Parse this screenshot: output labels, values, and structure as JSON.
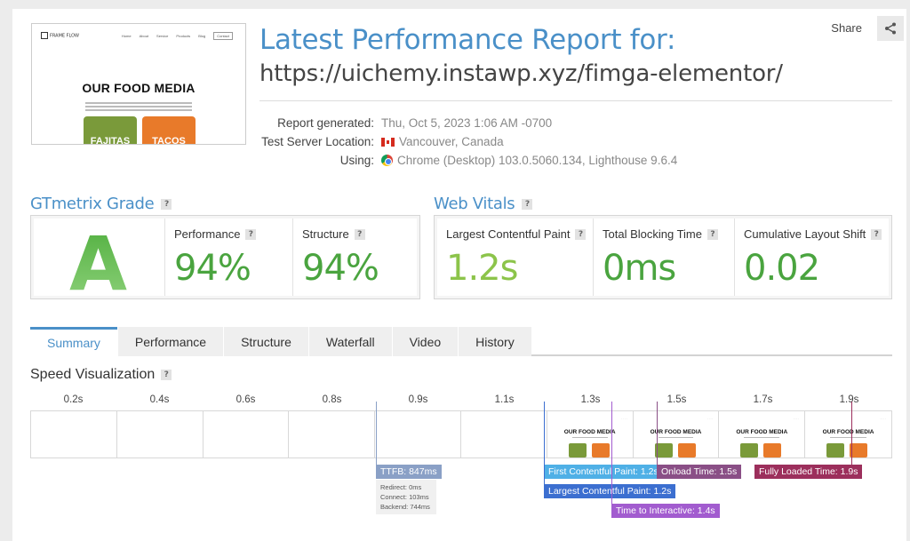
{
  "report": {
    "title": "Latest Performance Report for:",
    "url": "https://uichemy.instawp.xyz/fimga-elementor/",
    "share_label": "Share",
    "meta": [
      {
        "key": "Report generated:",
        "value": "Thu, Oct 5, 2023 1:06 AM -0700",
        "icon": ""
      },
      {
        "key": "Test Server Location:",
        "value": "Vancouver, Canada",
        "icon": "canada-flag-icon"
      },
      {
        "key": "Using:",
        "value": "Chrome (Desktop) 103.0.5060.134, Lighthouse 9.6.4",
        "icon": "chrome-icon"
      }
    ]
  },
  "thumbnail": {
    "logo": "FRAME FLOW",
    "nav": [
      "Home",
      "About",
      "Service",
      "Products",
      "Blog",
      "Contact"
    ],
    "hero": "OUR FOOD MEDIA",
    "card1": "FAJITAS",
    "card2": "TACOS"
  },
  "grade": {
    "heading": "GTmetrix Grade",
    "letter": "A",
    "performance_label": "Performance",
    "performance_value": "94%",
    "structure_label": "Structure",
    "structure_value": "94%"
  },
  "vitals": {
    "heading": "Web Vitals",
    "lcp_label": "Largest Contentful Paint",
    "lcp_value": "1.2s",
    "tbt_label": "Total Blocking Time",
    "tbt_value": "0ms",
    "cls_label": "Cumulative Layout Shift",
    "cls_value": "0.02"
  },
  "tabs": [
    "Summary",
    "Performance",
    "Structure",
    "Waterfall",
    "Video",
    "History"
  ],
  "active_tab": "Summary",
  "speed": {
    "heading": "Speed Visualization",
    "ticks": [
      "0.2s",
      "0.4s",
      "0.6s",
      "0.8s",
      "0.9s",
      "1.1s",
      "1.3s",
      "1.5s",
      "1.7s",
      "1.9s"
    ],
    "frames_loaded_from": 6,
    "frame_title": "OUR FOOD MEDIA",
    "markers": {
      "ttfb": "TTFB: 847ms",
      "ttfb_details": [
        "Redirect: 0ms",
        "Connect: 103ms",
        "Backend: 744ms"
      ],
      "fcp": "First Contentful Paint: 1.2s",
      "lcp": "Largest Contentful Paint: 1.2s",
      "tti": "Time to Interactive: 1.4s",
      "onload": "Onload Time: 1.5s",
      "fully": "Fully Loaded Time: 1.9s"
    },
    "colors": {
      "ttfb": "#8aa0c6",
      "fcp": "#4fb0e6",
      "lcp": "#3c6fd0",
      "tti": "#a25ccf",
      "onload": "#8a4f86",
      "fully": "#9c2f5c"
    }
  }
}
